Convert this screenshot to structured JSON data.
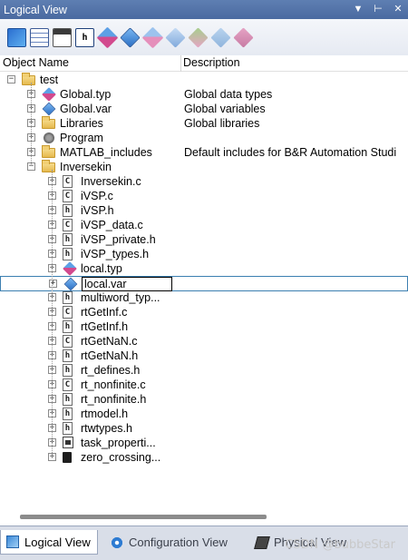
{
  "window": {
    "title": "Logical View",
    "controls": [
      "▼",
      "⊢",
      "✕"
    ]
  },
  "toolbar": {
    "buttons": [
      "open-icon",
      "table-icon",
      "properties-icon",
      "header-file-icon",
      "datatype-icon",
      "variable-icon",
      "add-datatype-icon",
      "add-variable-icon",
      "disabled-icon-1",
      "disabled-icon-2",
      "disabled-icon-3"
    ]
  },
  "columns": {
    "object_name": "Object Name",
    "description": "Description"
  },
  "tree": [
    {
      "label": "test",
      "desc": "",
      "level": 0,
      "expander": "−",
      "icon": "folder"
    },
    {
      "label": "Global.typ",
      "desc": "Global data types",
      "level": 1,
      "expander": "+",
      "icon": "typ"
    },
    {
      "label": "Global.var",
      "desc": "Global variables",
      "level": 1,
      "expander": "+",
      "icon": "var"
    },
    {
      "label": "Libraries",
      "desc": "Global libraries",
      "level": 1,
      "expander": "+",
      "icon": "folder"
    },
    {
      "label": "Program",
      "desc": "",
      "level": 1,
      "expander": "+",
      "icon": "prog"
    },
    {
      "label": "MATLAB_includes",
      "desc": "Default includes for B&R Automation Studi",
      "level": 1,
      "expander": "+",
      "icon": "folder"
    },
    {
      "label": "Inversekin",
      "desc": "",
      "level": 1,
      "expander": "−",
      "icon": "folder"
    },
    {
      "label": "Inversekin.c",
      "desc": "",
      "level": 2,
      "expander": "+",
      "icon": "file",
      "letter": "C"
    },
    {
      "label": "iVSP.c",
      "desc": "",
      "level": 2,
      "expander": "+",
      "icon": "file",
      "letter": "C"
    },
    {
      "label": "iVSP.h",
      "desc": "",
      "level": 2,
      "expander": "+",
      "icon": "file",
      "letter": "h"
    },
    {
      "label": "iVSP_data.c",
      "desc": "",
      "level": 2,
      "expander": "+",
      "icon": "file",
      "letter": "C"
    },
    {
      "label": "iVSP_private.h",
      "desc": "",
      "level": 2,
      "expander": "+",
      "icon": "file",
      "letter": "h"
    },
    {
      "label": "iVSP_types.h",
      "desc": "",
      "level": 2,
      "expander": "+",
      "icon": "file",
      "letter": "h"
    },
    {
      "label": "local.typ",
      "desc": "",
      "level": 2,
      "expander": "+",
      "icon": "typ"
    },
    {
      "label": "local.var",
      "desc": "",
      "level": 2,
      "expander": "+",
      "icon": "var",
      "selected": true
    },
    {
      "label": "multiword_typ...",
      "desc": "",
      "level": 2,
      "expander": "+",
      "icon": "file",
      "letter": "h"
    },
    {
      "label": "rtGetInf.c",
      "desc": "",
      "level": 2,
      "expander": "+",
      "icon": "file",
      "letter": "C"
    },
    {
      "label": "rtGetInf.h",
      "desc": "",
      "level": 2,
      "expander": "+",
      "icon": "file",
      "letter": "h"
    },
    {
      "label": "rtGetNaN.c",
      "desc": "",
      "level": 2,
      "expander": "+",
      "icon": "file",
      "letter": "C"
    },
    {
      "label": "rtGetNaN.h",
      "desc": "",
      "level": 2,
      "expander": "+",
      "icon": "file",
      "letter": "h"
    },
    {
      "label": "rt_defines.h",
      "desc": "",
      "level": 2,
      "expander": "+",
      "icon": "file",
      "letter": "h"
    },
    {
      "label": "rt_nonfinite.c",
      "desc": "",
      "level": 2,
      "expander": "+",
      "icon": "file",
      "letter": "C"
    },
    {
      "label": "rt_nonfinite.h",
      "desc": "",
      "level": 2,
      "expander": "+",
      "icon": "file",
      "letter": "h"
    },
    {
      "label": "rtmodel.h",
      "desc": "",
      "level": 2,
      "expander": "+",
      "icon": "file",
      "letter": "h"
    },
    {
      "label": "rtwtypes.h",
      "desc": "",
      "level": 2,
      "expander": "+",
      "icon": "file",
      "letter": "h"
    },
    {
      "label": "task_properti...",
      "desc": "",
      "level": 2,
      "expander": "+",
      "icon": "task"
    },
    {
      "label": "zero_crossing...",
      "desc": "",
      "level": 2,
      "expander": "+",
      "icon": "zc"
    }
  ],
  "tabs": [
    {
      "label": "Logical View",
      "active": true,
      "icon": "logical-view-icon"
    },
    {
      "label": "Configuration View",
      "active": false,
      "icon": "configuration-view-icon"
    },
    {
      "label": "Physical View",
      "active": false,
      "icon": "physical-view-icon"
    }
  ],
  "watermark": "CSDN @bubbeStar"
}
